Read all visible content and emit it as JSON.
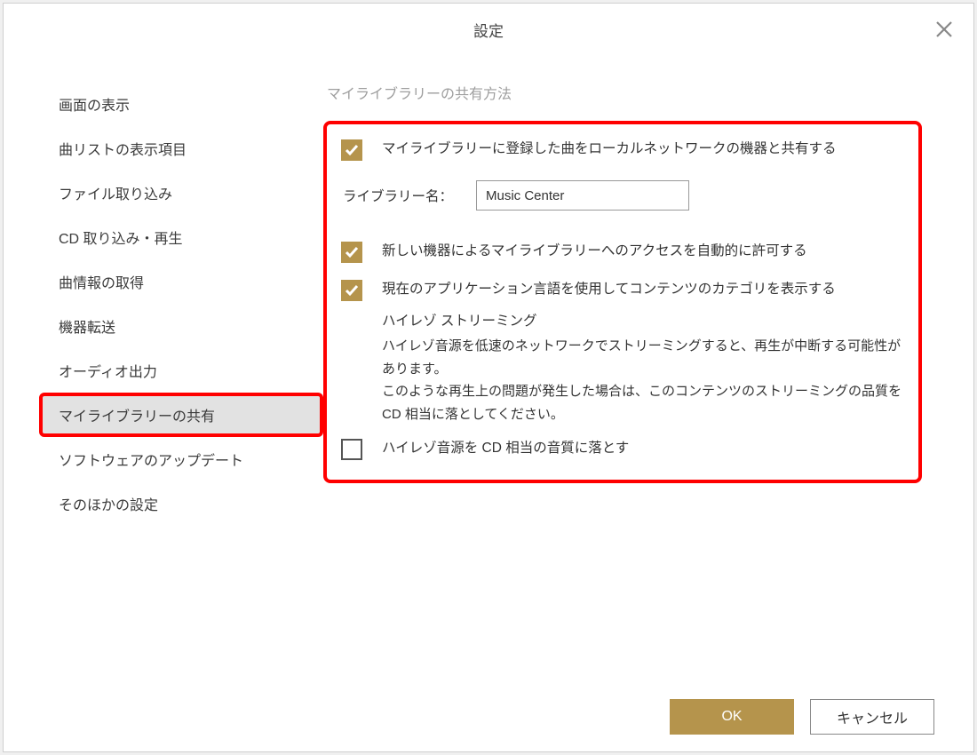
{
  "dialog": {
    "title": "設定",
    "close_label": "閉じる"
  },
  "sidebar": {
    "items": [
      {
        "label": "画面の表示",
        "selected": false
      },
      {
        "label": "曲リストの表示項目",
        "selected": false
      },
      {
        "label": "ファイル取り込み",
        "selected": false
      },
      {
        "label": "CD 取り込み・再生",
        "selected": false
      },
      {
        "label": "曲情報の取得",
        "selected": false
      },
      {
        "label": "機器転送",
        "selected": false
      },
      {
        "label": "オーディオ出力",
        "selected": false
      },
      {
        "label": "マイライブラリーの共有",
        "selected": true
      },
      {
        "label": "ソフトウェアのアップデート",
        "selected": false
      },
      {
        "label": "そのほかの設定",
        "selected": false
      }
    ]
  },
  "content": {
    "section_title": "マイライブラリーの共有方法",
    "share_checkbox": {
      "checked": true,
      "label": "マイライブラリーに登録した曲をローカルネットワークの機器と共有する"
    },
    "library_name": {
      "label": "ライブラリー名：",
      "value": "Music Center"
    },
    "auto_allow_checkbox": {
      "checked": true,
      "label": "新しい機器によるマイライブラリーへのアクセスを自動的に許可する"
    },
    "category_lang_checkbox": {
      "checked": true,
      "label": "現在のアプリケーション言語を使用してコンテンツのカテゴリを表示する"
    },
    "hires_heading": "ハイレゾ ストリーミング",
    "hires_desc": "ハイレゾ音源を低速のネットワークでストリーミングすると、再生が中断する可能性があります。\nこのような再生上の問題が発生した場合は、このコンテンツのストリーミングの品質を CD 相当に落としてください。",
    "downgrade_checkbox": {
      "checked": false,
      "label": "ハイレゾ音源を CD 相当の音質に落とす"
    }
  },
  "footer": {
    "ok_label": "OK",
    "cancel_label": "キャンセル"
  },
  "colors": {
    "accent": "#b5944c",
    "highlight": "#ff0000"
  }
}
